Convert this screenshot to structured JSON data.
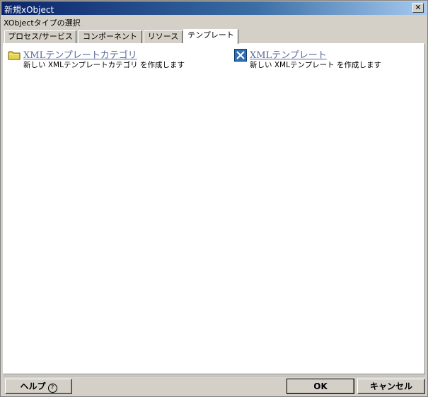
{
  "window": {
    "title": "新規xObject",
    "close_label": "✕",
    "subtitle": "XObjectタイプの選択"
  },
  "tabs": [
    {
      "label": "プロセス/サービス",
      "active": false
    },
    {
      "label": "コンポーネント",
      "active": false
    },
    {
      "label": "リソース",
      "active": false
    },
    {
      "label": "テンプレート",
      "active": true
    }
  ],
  "items": [
    {
      "icon": "folder-icon",
      "title": "XMLテンプレートカテゴリ",
      "description": "新しい XMLテンプレートカテゴリ を作成します"
    },
    {
      "icon": "xml-template-icon",
      "title": "XMLテンプレート",
      "description": "新しい XMLテンプレート を作成します"
    }
  ],
  "buttons": {
    "help": "ヘルプ",
    "help_glyph": "?",
    "ok": "OK",
    "cancel": "キャンセル"
  }
}
